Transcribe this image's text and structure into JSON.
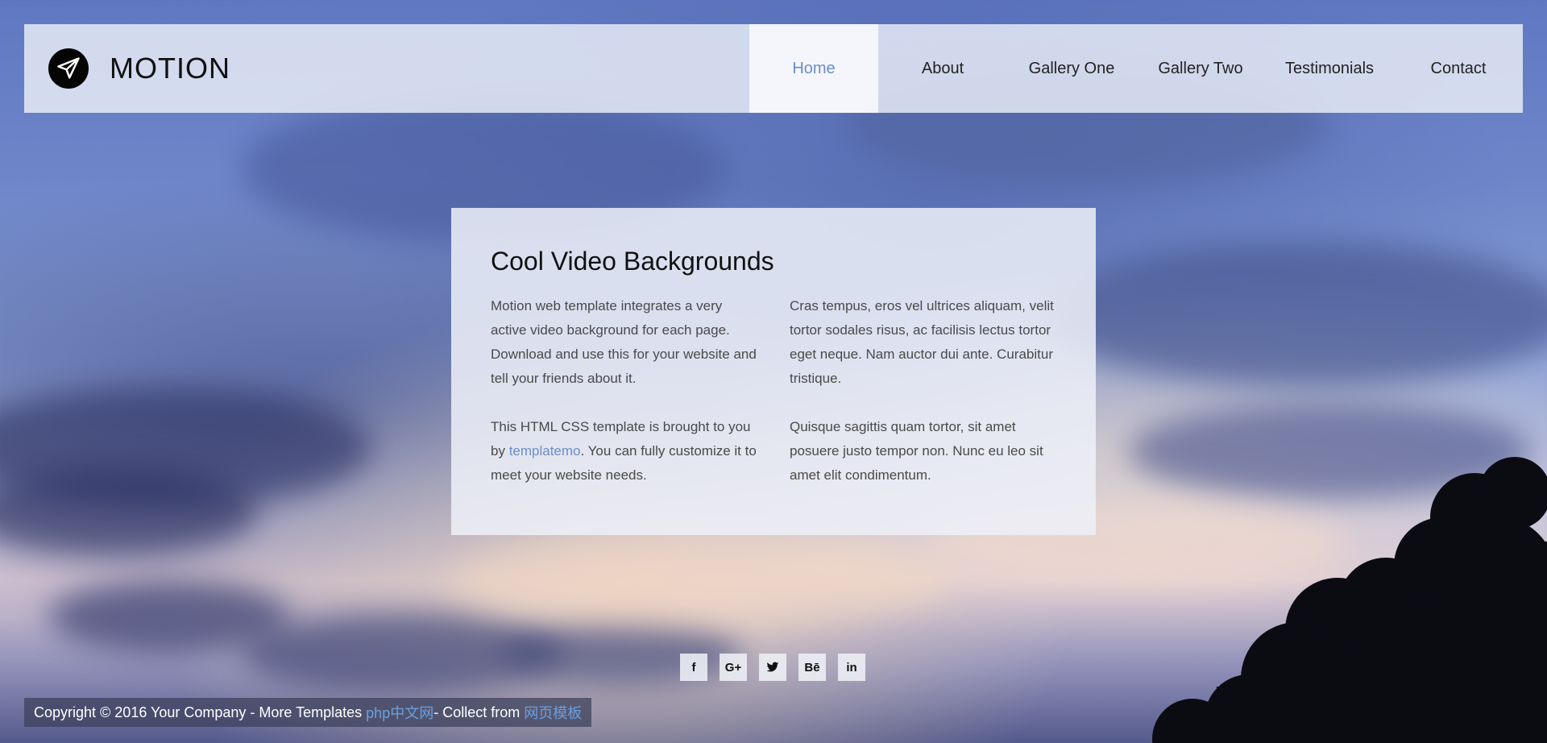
{
  "brand": {
    "name": "MOTION",
    "icon": "paper-plane-icon"
  },
  "nav": {
    "items": [
      {
        "label": "Home",
        "active": true
      },
      {
        "label": "About"
      },
      {
        "label": "Gallery One"
      },
      {
        "label": "Gallery Two"
      },
      {
        "label": "Testimonials"
      },
      {
        "label": "Contact"
      }
    ]
  },
  "content": {
    "title": "Cool Video Backgrounds",
    "left": {
      "p1": "Motion web template integrates a very active video background for each page. Download and use this for your website and tell your friends about it.",
      "p2_before": "This HTML CSS template is brought to you by ",
      "p2_link": "templatemo",
      "p2_after": ". You can fully customize it to meet your website needs."
    },
    "right": {
      "p1": "Cras tempus, eros vel ultrices aliquam, velit tortor sodales risus, ac facilisis lectus tortor eget neque. Nam auctor dui ante. Curabitur tristique.",
      "p2": "Quisque sagittis quam tortor, sit amet posuere justo tempor non. Nunc eu leo sit amet elit condimentum."
    }
  },
  "social": [
    {
      "label": "f",
      "icon": "facebook-icon"
    },
    {
      "label": "G+",
      "icon": "google-plus-icon"
    },
    {
      "label": "t",
      "icon": "twitter-icon"
    },
    {
      "label": "Bē",
      "icon": "behance-icon"
    },
    {
      "label": "in",
      "icon": "linkedin-icon"
    }
  ],
  "footer": {
    "text1": "Copyright © 2016 Your Company - More Templates ",
    "link1": "php中文网",
    "text2": " - Collect from ",
    "link2": "网页模板"
  },
  "colors": {
    "accent": "#6b8fc7",
    "link": "#6b9fe0"
  }
}
